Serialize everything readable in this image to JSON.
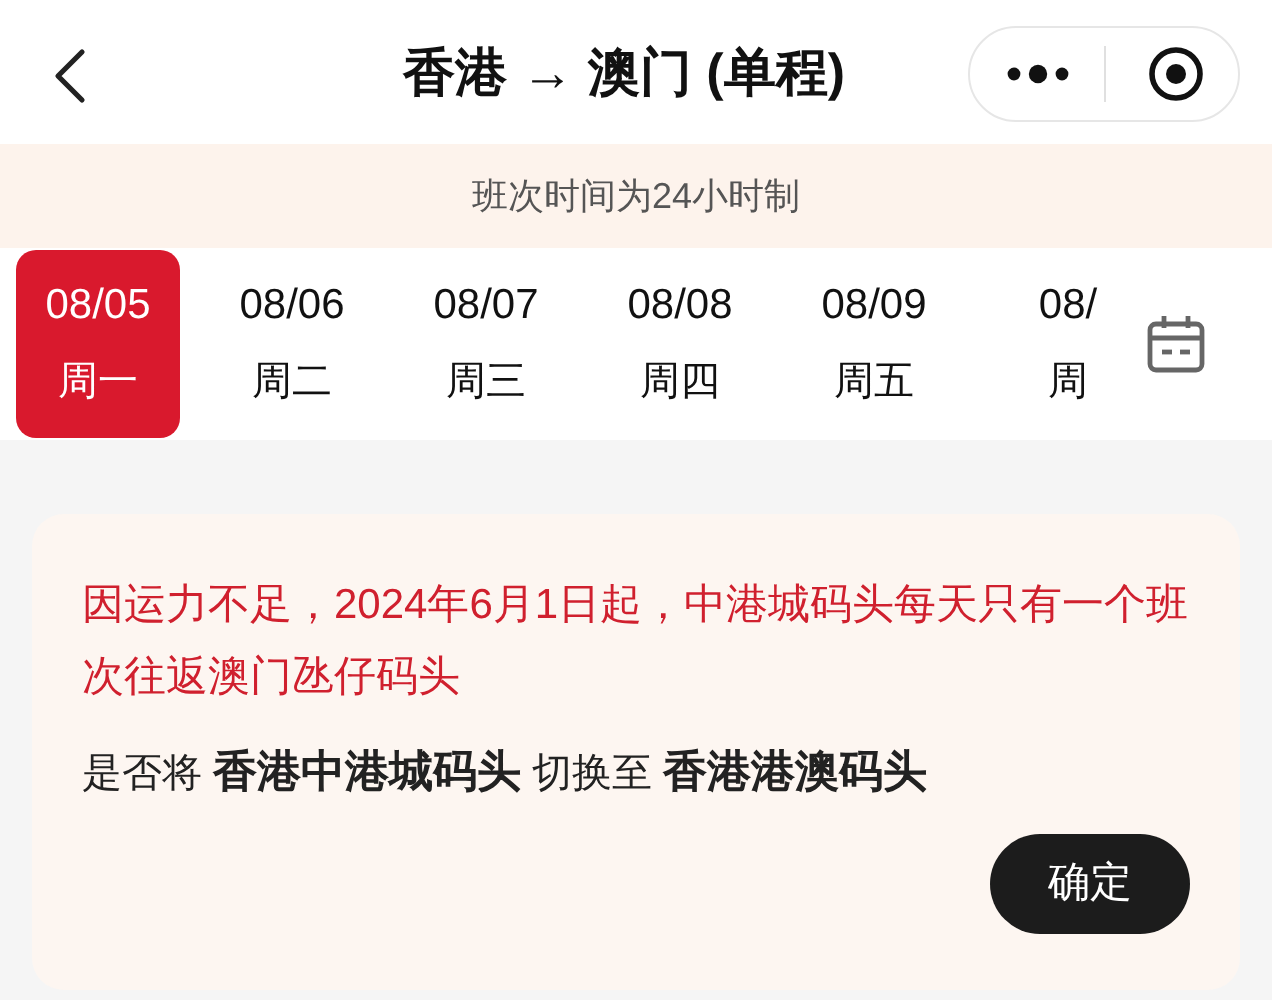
{
  "header": {
    "title": "香港 → 澳门 (单程)"
  },
  "notice": "班次时间为24小时制",
  "dates": [
    {
      "date": "08/05",
      "weekday": "周一",
      "selected": true
    },
    {
      "date": "08/06",
      "weekday": "周二",
      "selected": false
    },
    {
      "date": "08/07",
      "weekday": "周三",
      "selected": false
    },
    {
      "date": "08/08",
      "weekday": "周四",
      "selected": false
    },
    {
      "date": "08/09",
      "weekday": "周五",
      "selected": false
    },
    {
      "date": "08/",
      "weekday": "周",
      "selected": false
    }
  ],
  "dialog": {
    "warning": "因运力不足，2024年6月1日起，中港城码头每天只有一个班次往返澳门氹仔码头",
    "question": "是否将 **香港中港城码头** 切换至 **香港港澳码头**",
    "confirm": "确定"
  }
}
